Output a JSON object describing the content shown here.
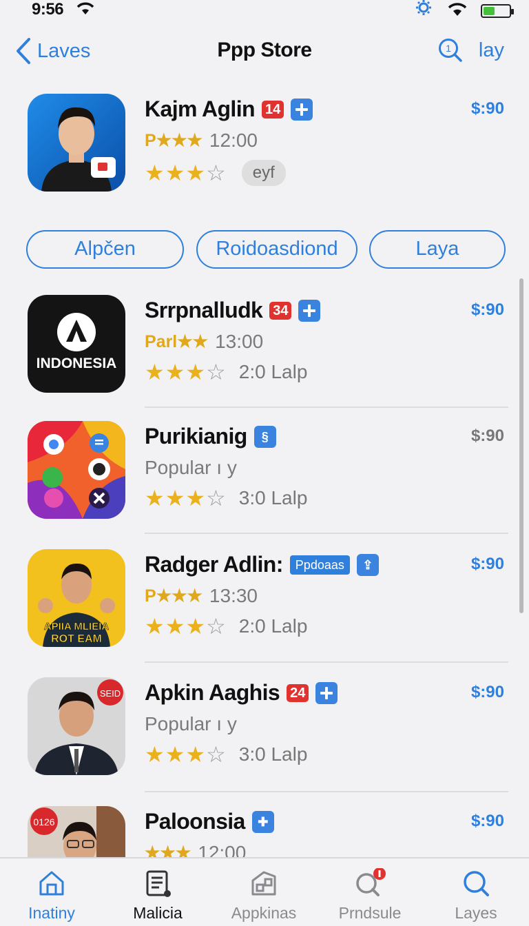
{
  "status": {
    "time": "9:56"
  },
  "nav": {
    "back_label": "Laves",
    "title": "Ppp Store",
    "right_label": "lay"
  },
  "featured": {
    "name": "Kajm Aglin",
    "badge": "14",
    "price": "$:90",
    "sub_prefix": "P★★★",
    "sub_value": "12:00",
    "rating": 3,
    "pill": "eyf"
  },
  "segments": [
    "Alpčen",
    "Roidoasdiond",
    "Laya"
  ],
  "apps": [
    {
      "name": "Srrpnalludk",
      "badge": "34",
      "price": "$:90",
      "sub_prefix": "Parl★★",
      "sub_value": "13:00",
      "rating": 3,
      "stars_text": "2:0 Lalp",
      "icon_text": "INDONESIA"
    },
    {
      "name": "Purikianig",
      "price": "$:90",
      "sub_value": "Popular ı y",
      "rating": 3,
      "stars_text": "3:0 Lalp"
    },
    {
      "name": "Radger Adlin:",
      "badge_text": "Ppdoaas",
      "price": "$:90",
      "sub_prefix": "P★★★",
      "sub_value": "13:30",
      "rating": 3,
      "stars_text": "2:0 Lalp",
      "icon_text_1": "APIIA MLIEIA",
      "icon_text_2": "ROT EAM"
    },
    {
      "name": "Apkin Aaghis",
      "badge": "24",
      "price": "$:90",
      "sub_value": "Popular ı y",
      "rating": 3,
      "stars_text": "3:0 Lalp",
      "icon_badge": "SEID"
    },
    {
      "name": "Paloonsia",
      "price": "$:90",
      "sub_value": "12:00",
      "icon_badge": "0126"
    }
  ],
  "tabs": [
    {
      "label": "Inatiny",
      "icon": "home-icon"
    },
    {
      "label": "Malicia",
      "icon": "document-icon"
    },
    {
      "label": "Appkinas",
      "icon": "apps-icon"
    },
    {
      "label": "Prndsule",
      "icon": "search-badge-icon"
    },
    {
      "label": "Layes",
      "icon": "search-icon"
    }
  ],
  "colors": {
    "accent": "#2f7fdc",
    "badge_red": "#e0322f",
    "star": "#eab11d"
  }
}
